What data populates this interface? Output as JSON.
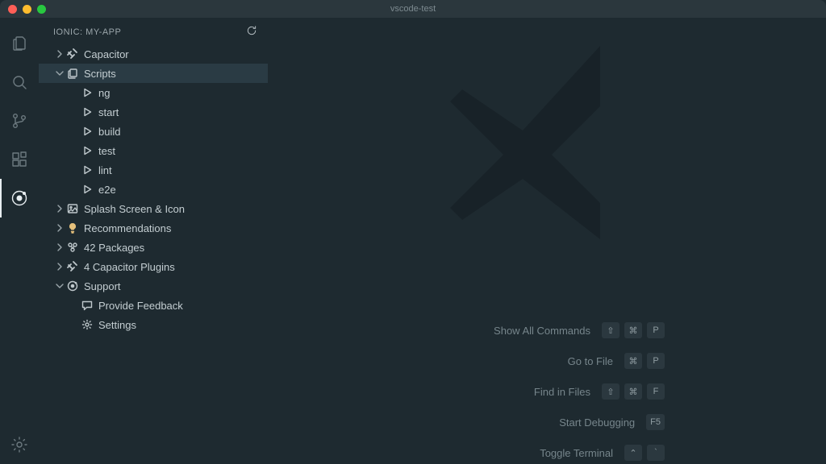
{
  "window": {
    "title": "vscode-test"
  },
  "panel": {
    "title": "IONIC: MY-APP"
  },
  "tree": {
    "capacitor": "Capacitor",
    "scripts": "Scripts",
    "script_items": [
      "ng",
      "start",
      "build",
      "test",
      "lint",
      "e2e"
    ],
    "splash": "Splash Screen & Icon",
    "recommendations": "Recommendations",
    "packages": "42 Packages",
    "plugins": "4 Capacitor Plugins",
    "support": "Support",
    "feedback": "Provide Feedback",
    "settings": "Settings"
  },
  "shortcuts": [
    {
      "label": "Show All Commands",
      "keys": [
        "⇧",
        "⌘",
        "P"
      ]
    },
    {
      "label": "Go to File",
      "keys": [
        "⌘",
        "P"
      ]
    },
    {
      "label": "Find in Files",
      "keys": [
        "⇧",
        "⌘",
        "F"
      ]
    },
    {
      "label": "Start Debugging",
      "keys": [
        "F5"
      ]
    },
    {
      "label": "Toggle Terminal",
      "keys": [
        "⌃",
        "`"
      ]
    }
  ]
}
